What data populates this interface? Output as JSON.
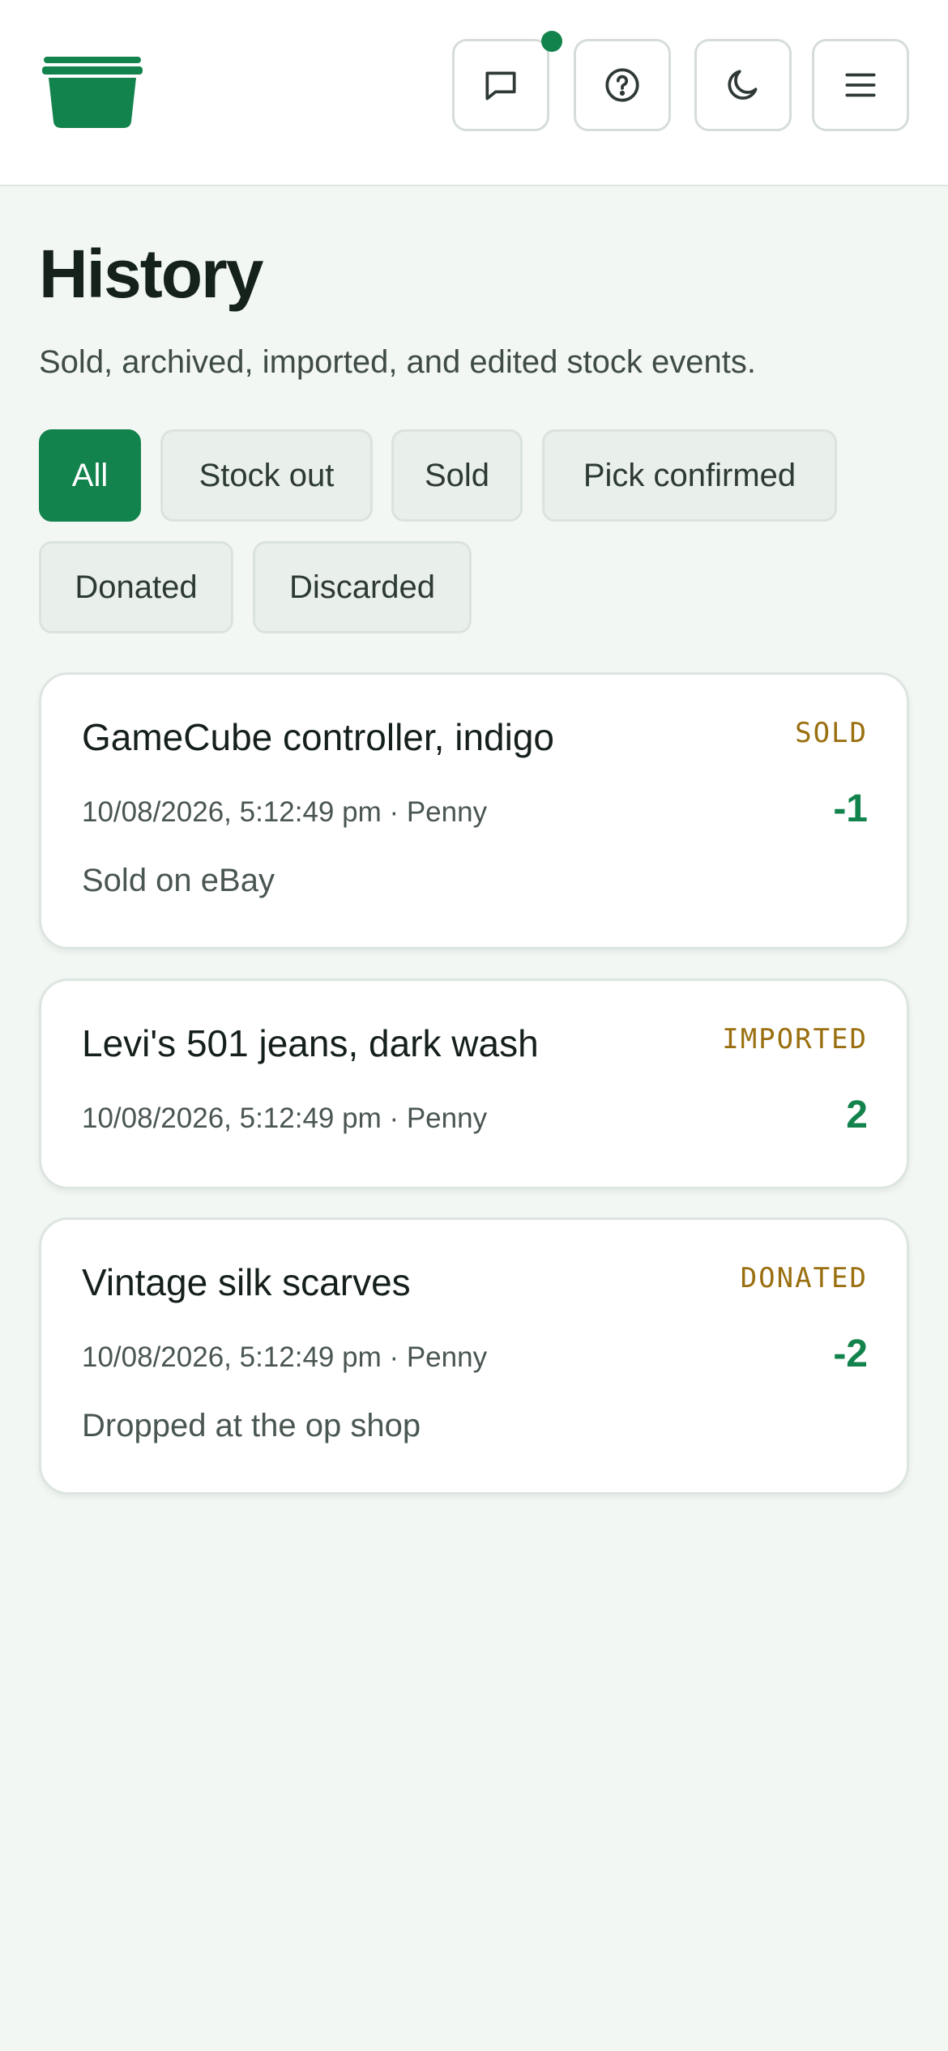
{
  "header": {
    "logo": "storage-bin-logo",
    "buttons": [
      {
        "icon": "chat-icon",
        "has_notification": true
      },
      {
        "icon": "help-icon"
      },
      {
        "icon": "moon-icon"
      },
      {
        "icon": "menu-icon"
      }
    ]
  },
  "page": {
    "title": "History",
    "subtitle": "Sold, archived, imported, and edited stock events."
  },
  "filters": [
    {
      "label": "All",
      "active": true
    },
    {
      "label": "Stock out",
      "active": false
    },
    {
      "label": "Sold",
      "active": false
    },
    {
      "label": "Pick confirmed",
      "active": false
    },
    {
      "label": "Donated",
      "active": false
    },
    {
      "label": "Discarded",
      "active": false
    }
  ],
  "events": [
    {
      "title": "GameCube controller, indigo",
      "badge": "SOLD",
      "meta": "10/08/2026, 5:12:49 pm · Penny",
      "qty": "-1",
      "note": "Sold on eBay"
    },
    {
      "title": "Levi's 501 jeans, dark wash",
      "badge": "IMPORTED",
      "meta": "10/08/2026, 5:12:49 pm · Penny",
      "qty": "2",
      "note": ""
    },
    {
      "title": "Vintage silk scarves",
      "badge": "DONATED",
      "meta": "10/08/2026, 5:12:49 pm · Penny",
      "qty": "-2",
      "note": "Dropped at the op shop"
    }
  ],
  "colors": {
    "brand": "#13834d",
    "badge": "#9a6f10",
    "background": "#f3f7f4"
  }
}
